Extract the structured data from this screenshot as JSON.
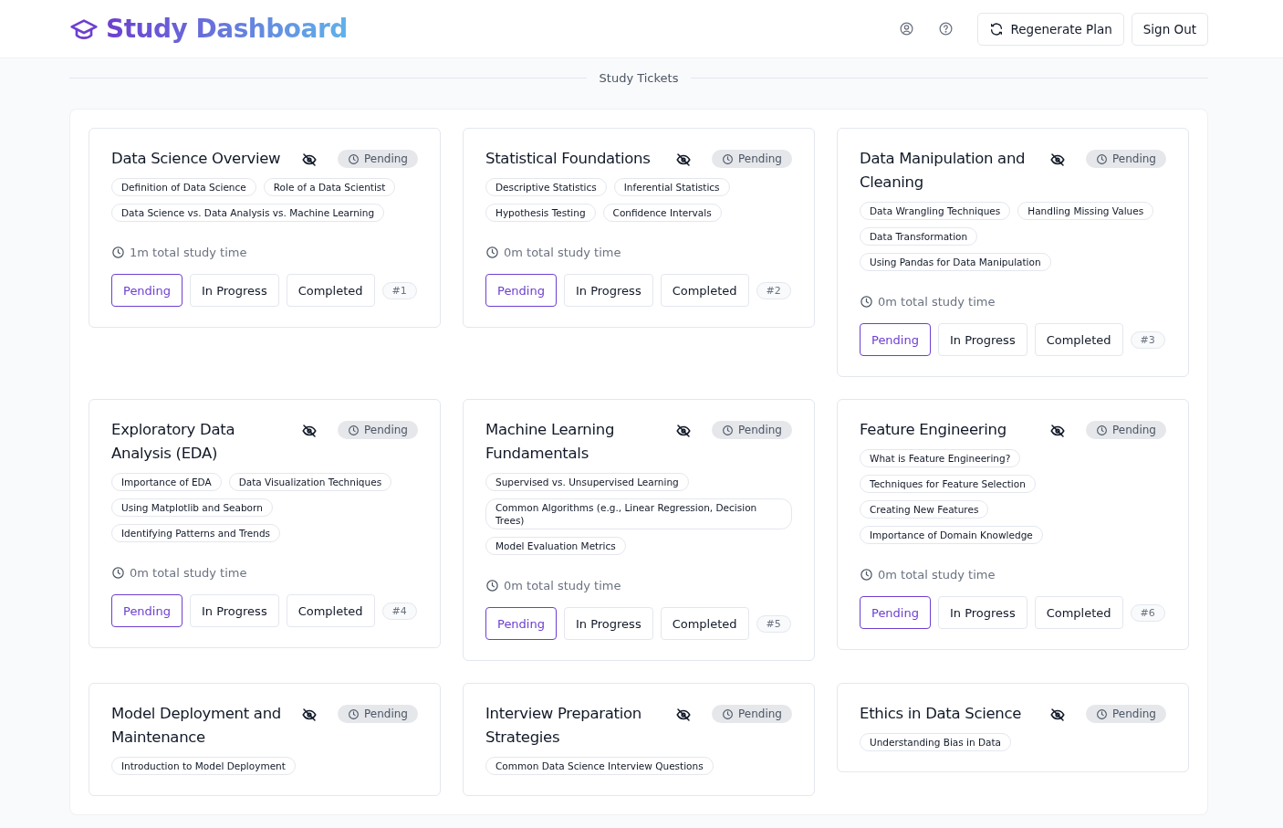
{
  "header": {
    "title": "Study Dashboard",
    "buttons": [
      {
        "kind": "regenerate",
        "label": "Regenerate Plan"
      },
      {
        "kind": "plain",
        "label": "Sign Out"
      }
    ]
  },
  "section_title": "Study Tickets",
  "tickets": [
    {
      "title": "Data Science Overview",
      "badge": "Pending",
      "topics": [
        "Definition of Data Science",
        "Role of a Data Scientist",
        "Data Science vs. Data Analysis vs. Machine Learning"
      ],
      "study_time": "1m total study time",
      "statuses": [
        {
          "label": "Pending",
          "selected": true
        },
        {
          "label": "In Progress",
          "selected": false
        },
        {
          "label": "Completed",
          "selected": false
        }
      ],
      "number": "#1"
    },
    {
      "title": "Statistical Foundations",
      "badge": "Pending",
      "topics": [
        "Descriptive Statistics",
        "Inferential Statistics",
        "Hypothesis Testing",
        "Confidence Intervals"
      ],
      "study_time": "0m total study time",
      "statuses": [
        {
          "label": "Pending",
          "selected": true
        },
        {
          "label": "In Progress",
          "selected": false
        },
        {
          "label": "Completed",
          "selected": false
        }
      ],
      "number": "#2"
    },
    {
      "title": "Data Manipulation and Cleaning",
      "badge": "Pending",
      "topics": [
        "Data Wrangling Techniques",
        "Handling Missing Values",
        "Data Transformation",
        "Using Pandas for Data Manipulation"
      ],
      "study_time": "0m total study time",
      "statuses": [
        {
          "label": "Pending",
          "selected": true
        },
        {
          "label": "In Progress",
          "selected": false
        },
        {
          "label": "Completed",
          "selected": false
        }
      ],
      "number": "#3"
    },
    {
      "title": "Exploratory Data Analysis (EDA)",
      "badge": "Pending",
      "topics": [
        "Importance of EDA",
        "Data Visualization Techniques",
        "Using Matplotlib and Seaborn",
        "Identifying Patterns and Trends"
      ],
      "study_time": "0m total study time",
      "statuses": [
        {
          "label": "Pending",
          "selected": true
        },
        {
          "label": "In Progress",
          "selected": false
        },
        {
          "label": "Completed",
          "selected": false
        }
      ],
      "number": "#4"
    },
    {
      "title": "Machine Learning Fundamentals",
      "badge": "Pending",
      "topics": [
        "Supervised vs. Unsupervised Learning",
        "Common Algorithms (e.g., Linear Regression, Decision Trees)",
        "Model Evaluation Metrics"
      ],
      "study_time": "0m total study time",
      "statuses": [
        {
          "label": "Pending",
          "selected": true
        },
        {
          "label": "In Progress",
          "selected": false
        },
        {
          "label": "Completed",
          "selected": false
        }
      ],
      "number": "#5"
    },
    {
      "title": "Feature Engineering",
      "badge": "Pending",
      "topics": [
        "What is Feature Engineering?",
        "Techniques for Feature Selection",
        "Creating New Features",
        "Importance of Domain Knowledge"
      ],
      "study_time": "0m total study time",
      "statuses": [
        {
          "label": "Pending",
          "selected": true
        },
        {
          "label": "In Progress",
          "selected": false
        },
        {
          "label": "Completed",
          "selected": false
        }
      ],
      "number": "#6"
    },
    {
      "title": "Model Deployment and Maintenance",
      "badge": "Pending",
      "topics": [
        "Introduction to Model Deployment"
      ]
    },
    {
      "title": "Interview Preparation Strategies",
      "badge": "Pending",
      "topics": [
        "Common Data Science Interview Questions"
      ]
    },
    {
      "title": "Ethics in Data Science",
      "badge": "Pending",
      "topics": [
        "Understanding Bias in Data"
      ]
    }
  ]
}
